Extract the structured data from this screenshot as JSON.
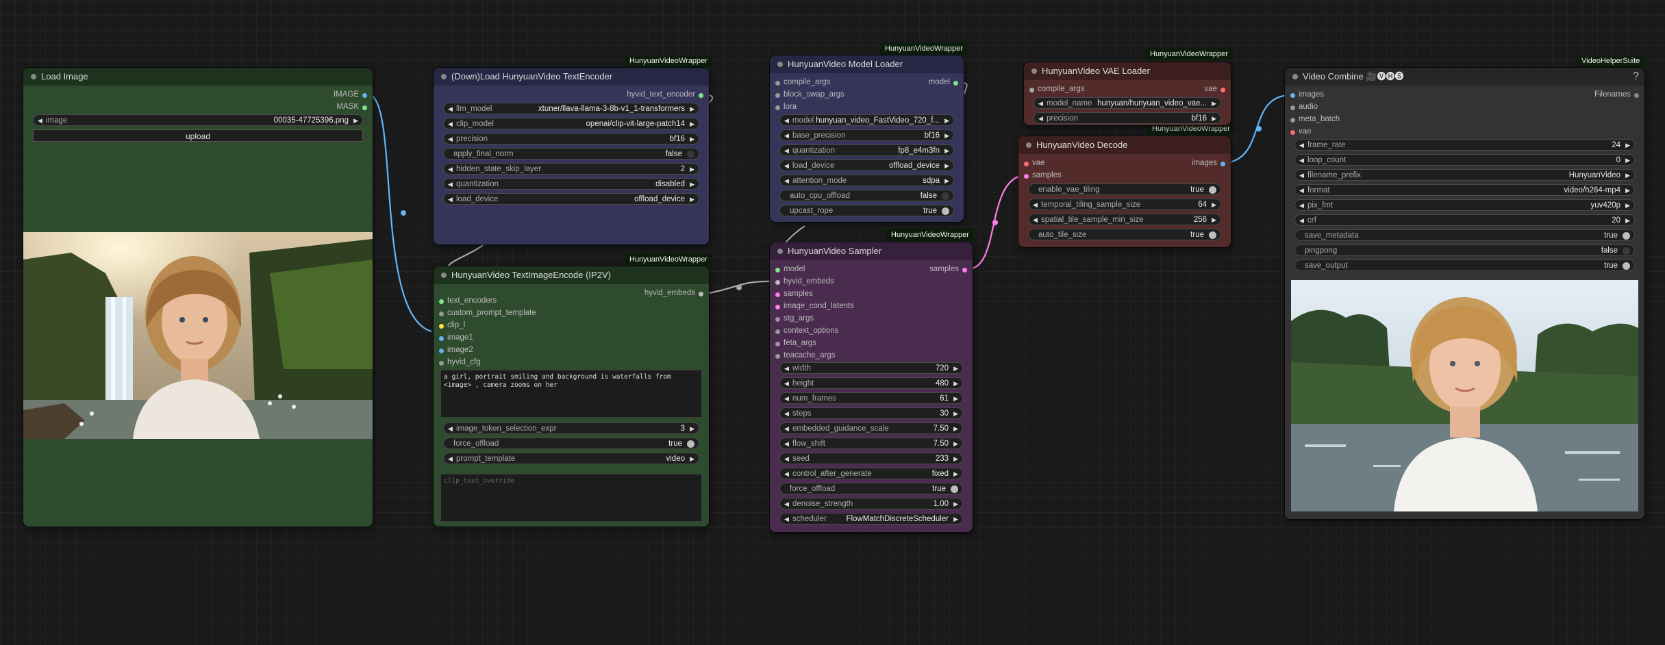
{
  "colors": {
    "green": "#2e4b2e",
    "blue": "#35355a",
    "purple": "#4a2c4f",
    "red": "#532b2b",
    "dark": "#333333"
  },
  "load_image": {
    "title": "Load Image",
    "out_image": "IMAGE",
    "out_mask": "MASK",
    "image_label": "image",
    "image_value": "00035-47725396.png",
    "upload_label": "upload"
  },
  "text_encoder": {
    "badge": "HunyuanVideoWrapper",
    "title": "(Down)Load HunyuanVideo TextEncoder",
    "out": "hyvid_text_encoder",
    "widgets": [
      {
        "label": "llm_model",
        "value": "xtuner/llava-llama-3-8b-v1_1-transformers"
      },
      {
        "label": "clip_model",
        "value": "openai/clip-vit-large-patch14"
      },
      {
        "label": "precision",
        "value": "bf16"
      },
      {
        "label": "apply_final_norm",
        "value": "false"
      },
      {
        "label": "hidden_state_skip_layer",
        "value": "2"
      },
      {
        "label": "quantization",
        "value": "disabled"
      },
      {
        "label": "load_device",
        "value": "offload_device"
      }
    ]
  },
  "image_encode": {
    "badge": "HunyuanVideoWrapper",
    "title": "HunyuanVideo TextImageEncode (IP2V)",
    "inputs": [
      "text_encoders",
      "custom_prompt_template",
      "clip_l",
      "image1",
      "image2",
      "hyvid_cfg"
    ],
    "out": "hyvid_embeds",
    "prompt": "a girl,  portrait smiling and background is waterfalls from <image> , camera zooms on her",
    "widgets": [
      {
        "label": "image_token_selection_expr",
        "value": "3"
      },
      {
        "label": "force_offload",
        "value": "true"
      },
      {
        "label": "prompt_template",
        "value": "video"
      }
    ],
    "override_placeholder": "clip_text_override"
  },
  "model_loader": {
    "badge": "HunyuanVideoWrapper",
    "title": "HunyuanVideo Model Loader",
    "inputs": [
      "compile_args",
      "block_swap_args",
      "lora"
    ],
    "out": "model",
    "widgets": [
      {
        "label": "model",
        "value": "hunyuan_video_FastVideo_720_f..."
      },
      {
        "label": "base_precision",
        "value": "bf16"
      },
      {
        "label": "quantization",
        "value": "fp8_e4m3fn"
      },
      {
        "label": "load_device",
        "value": "offload_device"
      },
      {
        "label": "attention_mode",
        "value": "sdpa"
      },
      {
        "label": "auto_cpu_offload",
        "value": "false"
      },
      {
        "label": "upcast_rope",
        "value": "true"
      }
    ]
  },
  "sampler": {
    "badge": "HunyuanVideoWrapper",
    "title": "HunyuanVideo Sampler",
    "inputs": [
      "model",
      "hyvid_embeds",
      "samples",
      "image_cond_latents",
      "stg_args",
      "context_options",
      "feta_args",
      "teacache_args"
    ],
    "out": "samples",
    "widgets": [
      {
        "label": "width",
        "value": "720"
      },
      {
        "label": "height",
        "value": "480"
      },
      {
        "label": "num_frames",
        "value": "61"
      },
      {
        "label": "steps",
        "value": "30"
      },
      {
        "label": "embedded_guidance_scale",
        "value": "7.50"
      },
      {
        "label": "flow_shift",
        "value": "7.50"
      },
      {
        "label": "seed",
        "value": "233"
      },
      {
        "label": "control_after_generate",
        "value": "fixed"
      },
      {
        "label": "force_offload",
        "value": "true"
      },
      {
        "label": "denoise_strength",
        "value": "1.00"
      },
      {
        "label": "scheduler",
        "value": "FlowMatchDiscreteScheduler"
      }
    ]
  },
  "vae_loader": {
    "badge": "HunyuanVideoWrapper",
    "title": "HunyuanVideo VAE Loader",
    "input": "compile_args",
    "out": "vae",
    "widgets": [
      {
        "label": "model_name",
        "value": "hunyuan/hunyuan_video_vae..."
      },
      {
        "label": "precision",
        "value": "bf16"
      }
    ]
  },
  "decode": {
    "badge": "HunyuanVideoWrapper",
    "title": "HunyuanVideo Decode",
    "inputs": [
      "vae",
      "samples"
    ],
    "out": "images",
    "widgets": [
      {
        "label": "enable_vae_tiling",
        "value": "true"
      },
      {
        "label": "temporal_tiling_sample_size",
        "value": "64"
      },
      {
        "label": "spatial_tile_sample_min_size",
        "value": "256"
      },
      {
        "label": "auto_tile_size",
        "value": "true"
      }
    ]
  },
  "video_combine": {
    "badge": "VideoHelperSuite",
    "title": "Video Combine 🎥🅥🅗🅢",
    "help": "?",
    "inputs": [
      "images",
      "audio",
      "meta_batch",
      "vae"
    ],
    "out": "Filenames",
    "widgets": [
      {
        "label": "frame_rate",
        "value": "24"
      },
      {
        "label": "loop_count",
        "value": "0"
      },
      {
        "label": "filename_prefix",
        "value": "HunyuanVideo"
      },
      {
        "label": "format",
        "value": "video/h264-mp4"
      },
      {
        "label": "pix_fmt",
        "value": "yuv420p"
      },
      {
        "label": "crf",
        "value": "20"
      },
      {
        "label": "save_metadata",
        "value": "true"
      },
      {
        "label": "pingpong",
        "value": "false"
      },
      {
        "label": "save_output",
        "value": "true"
      }
    ]
  }
}
